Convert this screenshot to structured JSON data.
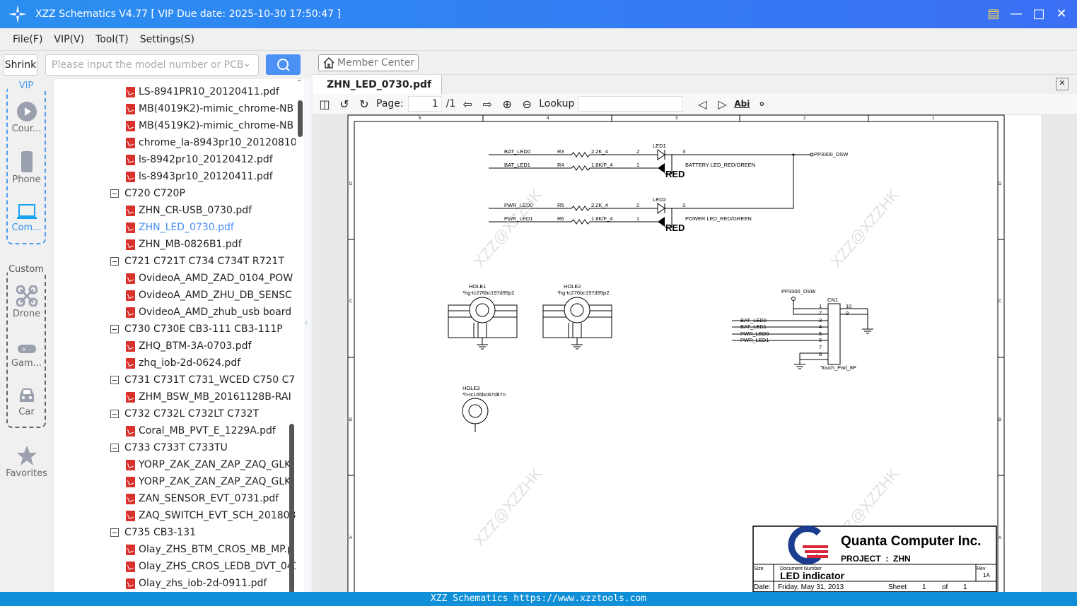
{
  "window": {
    "title": "XZZ Schematics V4.77 [ VIP Due date: 2025-10-30 17:50:47 ]"
  },
  "menu": [
    "File(F)",
    "VIP(V)",
    "Tool(T)",
    "Settings(S)"
  ],
  "search": {
    "shrink": "Shrink",
    "placeholder": "Please input the model number or PCB"
  },
  "categories": {
    "vip_label": "VIP",
    "custom_label": "Custom",
    "items": [
      {
        "label": "Cour...",
        "icon": "play-icon"
      },
      {
        "label": "Phone",
        "icon": "phone-icon"
      },
      {
        "label": "Com...",
        "icon": "laptop-icon",
        "active": true
      },
      {
        "label": "Drone",
        "icon": "drone-icon"
      },
      {
        "label": "Gam...",
        "icon": "gamepad-icon"
      },
      {
        "label": "Car",
        "icon": "car-icon"
      },
      {
        "label": "Favorites",
        "icon": "star-icon"
      }
    ]
  },
  "tree": [
    {
      "t": "f",
      "l": "LS-8941PR10_20120411.pdf"
    },
    {
      "t": "f",
      "l": "MB(4019K2)-mimic_chrome-NB"
    },
    {
      "t": "f",
      "l": "MB(4519K2)-mimic_chrome-NB"
    },
    {
      "t": "f",
      "l": "chrome_la-8943pr10_20120810"
    },
    {
      "t": "f",
      "l": "ls-8942pr10_20120412.pdf"
    },
    {
      "t": "f",
      "l": "ls-8943pr10_20120411.pdf"
    },
    {
      "t": "d",
      "l": "C720 C720P"
    },
    {
      "t": "f",
      "l": "ZHN_CR-USB_0730.pdf"
    },
    {
      "t": "f",
      "l": "ZHN_LED_0730.pdf",
      "sel": true
    },
    {
      "t": "f",
      "l": "ZHN_MB-0826B1.pdf"
    },
    {
      "t": "d",
      "l": "C721 C721T C734 C734T R721T"
    },
    {
      "t": "f",
      "l": "OvideoA_AMD_ZAD_0104_POW"
    },
    {
      "t": "f",
      "l": "OvideoA_AMD_ZHU_DB_SENSC"
    },
    {
      "t": "f",
      "l": "OvideoA_AMD_zhub_usb board"
    },
    {
      "t": "d",
      "l": "C730 C730E CB3-111 CB3-111P"
    },
    {
      "t": "f",
      "l": "ZHQ_BTM-3A-0703.pdf"
    },
    {
      "t": "f",
      "l": "zhq_iob-2d-0624.pdf"
    },
    {
      "t": "d",
      "l": "C731 C731T C731_WCED C750 C75("
    },
    {
      "t": "f",
      "l": "ZHM_BSW_MB_20161128B-RAI"
    },
    {
      "t": "d",
      "l": "C732 C732L C732LT C732T"
    },
    {
      "t": "f",
      "l": "Coral_MB_PVT_E_1229A.pdf"
    },
    {
      "t": "d",
      "l": "C733 C733T C733TU"
    },
    {
      "t": "f",
      "l": "YORP_ZAK_ZAN_ZAP_ZAQ_GLK"
    },
    {
      "t": "f",
      "l": "YORP_ZAK_ZAN_ZAP_ZAQ_GLK"
    },
    {
      "t": "f",
      "l": "ZAN_SENSOR_EVT_0731.pdf"
    },
    {
      "t": "f",
      "l": "ZAQ_SWITCH_EVT_SCH_201808"
    },
    {
      "t": "d",
      "l": "C735 CB3-131"
    },
    {
      "t": "f",
      "l": "Olay_ZHS_BTM_CROS_MB_MP.p"
    },
    {
      "t": "f",
      "l": "Olay_ZHS_CROS_LEDB_DVT_041"
    },
    {
      "t": "f",
      "l": "Olay_zhs_iob-2d-0911.pdf"
    }
  ],
  "viewer": {
    "member_center": "Member Center",
    "tab": "ZHN_LED_0730.pdf",
    "page_label": "Page:",
    "page": "1",
    "page_total": "/1",
    "lookup": "Lookup",
    "abi": "Abi"
  },
  "schematic": {
    "col_labels": [
      "5",
      "4",
      "3",
      "2",
      "1"
    ],
    "row_labels": [
      "D",
      "C",
      "B",
      "A"
    ],
    "bat_led0": "BAT_LED0",
    "bat_led1": "BAT_LED1",
    "pwr_led0": "PWR_LED0",
    "pwr_led1": "PWR_LED1",
    "r3": "R3",
    "r4": "R4",
    "r5": "R5",
    "r6": "R6",
    "v22k": "2.2K_4",
    "v18k": "1.8K/F_4",
    "led1": "LED1",
    "led2": "LED2",
    "red": "RED",
    "bat_desc": "BATTERY LED_RED/GREEN",
    "pwr_desc": "POWER LED_RED/GREEN",
    "pp3300": "PP3300_DSW",
    "hole1": "HOLE1",
    "hole2": "HOLE2",
    "hole3": "HOLE3",
    "hole_part": "*hg-tc276bc197d95p2",
    "hole3_part": "*h-tc165bc87d87n",
    "cn1": "CN1",
    "cn1_part": "Touch_Pad_8P",
    "watermark": "XZZ@XZZHK",
    "company": "Quanta Computer Inc.",
    "project": "PROJECT  :  ZHN",
    "size": "Size",
    "docnum_label": "Document Number",
    "docnum": "LED indicator",
    "rev_label": "Rev",
    "rev": "1A",
    "date_label": "Date:",
    "date": "Friday, May 31, 2013",
    "sheet_label": "Sheet",
    "sheet": "1",
    "of": "of",
    "sheets": "1"
  },
  "footer": "XZZ Schematics https://www.xzztools.com",
  "colors": {
    "accent": "#4a90f5",
    "title_start": "#2a8ff0",
    "footer": "#0f8fd8",
    "pdf": "#d9312b"
  }
}
